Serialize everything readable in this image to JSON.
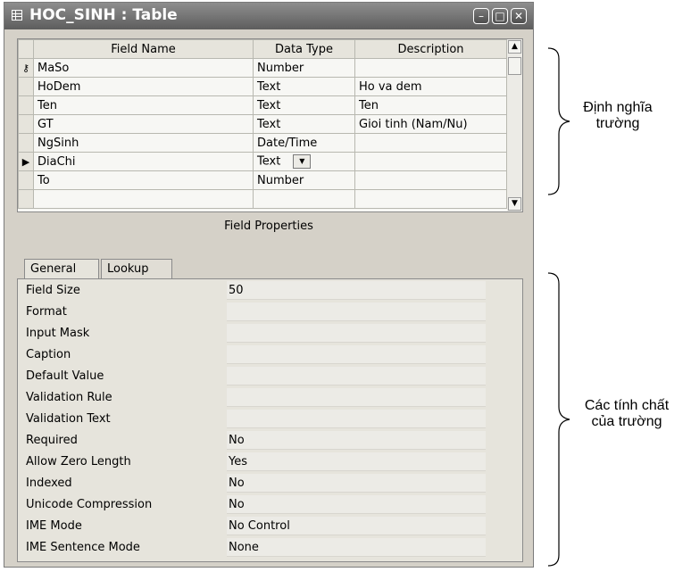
{
  "window": {
    "title": "HOC_SINH : Table",
    "controls": {
      "minimize": "–",
      "maximize": "□",
      "close": "✕"
    }
  },
  "grid": {
    "columns": [
      "Field Name",
      "Data Type",
      "Description"
    ],
    "rows": [
      {
        "indicator": "key-icon",
        "field": "MaSo",
        "type": "Number",
        "desc": ""
      },
      {
        "indicator": "",
        "field": "HoDem",
        "type": "Text",
        "desc": "Ho va dem"
      },
      {
        "indicator": "",
        "field": "Ten",
        "type": "Text",
        "desc": "Ten"
      },
      {
        "indicator": "",
        "field": "GT",
        "type": "Text",
        "desc": "Gioi tinh (Nam/Nu)"
      },
      {
        "indicator": "",
        "field": "NgSinh",
        "type": "Date/Time",
        "desc": ""
      },
      {
        "indicator": "current-row-arrow",
        "field": "DiaChi",
        "type": "Text",
        "desc": ""
      },
      {
        "indicator": "",
        "field": "To",
        "type": "Number",
        "desc": ""
      },
      {
        "indicator": "",
        "field": "",
        "type": "",
        "desc": ""
      }
    ]
  },
  "field_properties_label": "Field Properties",
  "tabs": [
    "General",
    "Lookup"
  ],
  "properties": [
    {
      "name": "Field Size",
      "value": "50"
    },
    {
      "name": "Format",
      "value": ""
    },
    {
      "name": "Input Mask",
      "value": ""
    },
    {
      "name": "Caption",
      "value": ""
    },
    {
      "name": "Default Value",
      "value": ""
    },
    {
      "name": "Validation Rule",
      "value": ""
    },
    {
      "name": "Validation Text",
      "value": ""
    },
    {
      "name": "Required",
      "value": "No"
    },
    {
      "name": "Allow Zero Length",
      "value": "Yes"
    },
    {
      "name": "Indexed",
      "value": "No"
    },
    {
      "name": "Unicode Compression",
      "value": "No"
    },
    {
      "name": "IME Mode",
      "value": "No Control"
    },
    {
      "name": "IME Sentence Mode",
      "value": "None"
    }
  ],
  "annotations": {
    "field_definition": [
      "Định nghĩa",
      "trường"
    ],
    "field_properties": [
      "Các tính chất",
      "của trường"
    ]
  }
}
